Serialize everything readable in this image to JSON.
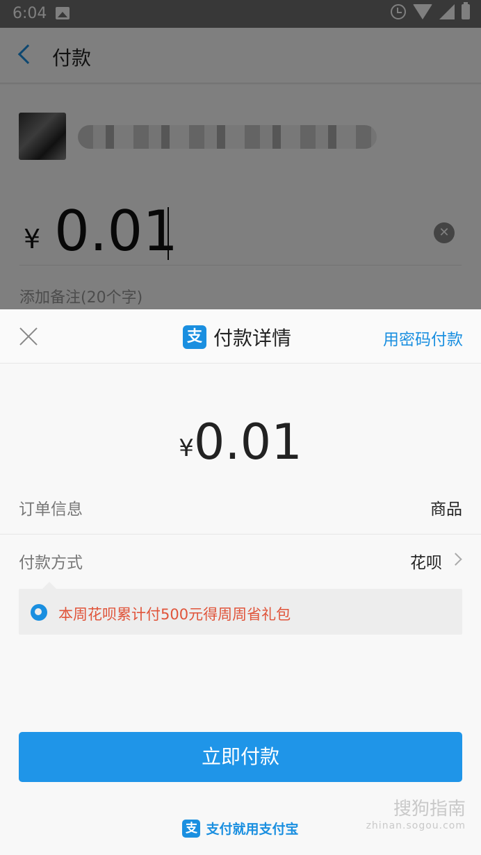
{
  "status_bar": {
    "time": "6:04"
  },
  "background": {
    "header_title": "付款",
    "currency_symbol": "¥",
    "amount": "0.01",
    "memo_placeholder": "添加备注(20个字)"
  },
  "sheet": {
    "title": "付款详情",
    "alt_action": "用密码付款",
    "currency_symbol": "¥",
    "amount": "0.01",
    "order_info_label": "订单信息",
    "order_info_value": "商品",
    "payment_method_label": "付款方式",
    "payment_method_value": "花呗",
    "promo_text": "本周花呗累计付500元得周周省礼包",
    "pay_button": "立即付款",
    "footer_slogan": "支付就用支付宝"
  },
  "watermark": {
    "main": "搜狗指南",
    "url": "zhinan.sogou.com"
  },
  "colors": {
    "accent": "#1f95e8",
    "promo": "#e0543a"
  }
}
